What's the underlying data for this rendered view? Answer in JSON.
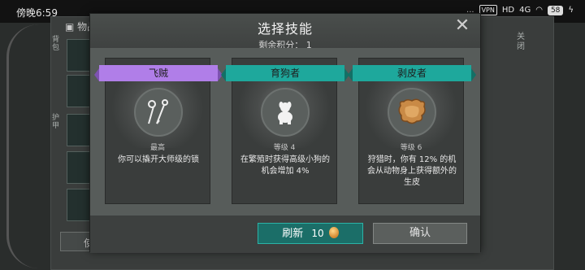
{
  "status_bar": {
    "time": "傍晚6:59",
    "indicators": [
      "...",
      "VPN",
      "HD",
      "4G"
    ],
    "battery": "58"
  },
  "background": {
    "header": "物品",
    "side_tabs": [
      "背包",
      "护甲"
    ],
    "right_label": "关闭",
    "bottom_button": "使"
  },
  "modal": {
    "title": "选择技能",
    "subtitle": "剩余积分：  1",
    "close_icon": "close-icon"
  },
  "skills": [
    {
      "name": "飞贼",
      "ribbon_color": "#b07ee8",
      "icon": "lockpick-icon",
      "level": "最高",
      "description": "你可以撬开大师级的锁"
    },
    {
      "name": "育狗者",
      "ribbon_color": "#1ea89c",
      "icon": "dog-icon",
      "level": "等级 4",
      "description": "在繁殖时获得高级小狗的机会增加 4%"
    },
    {
      "name": "剥皮者",
      "ribbon_color": "#1ea89c",
      "icon": "hide-icon",
      "level": "等级 6",
      "description": "狩猎时，你有 12% 的机会从动物身上获得额外的生皮"
    }
  ],
  "footer": {
    "refresh_label": "刷新",
    "refresh_cost": "10",
    "confirm_label": "确认"
  }
}
